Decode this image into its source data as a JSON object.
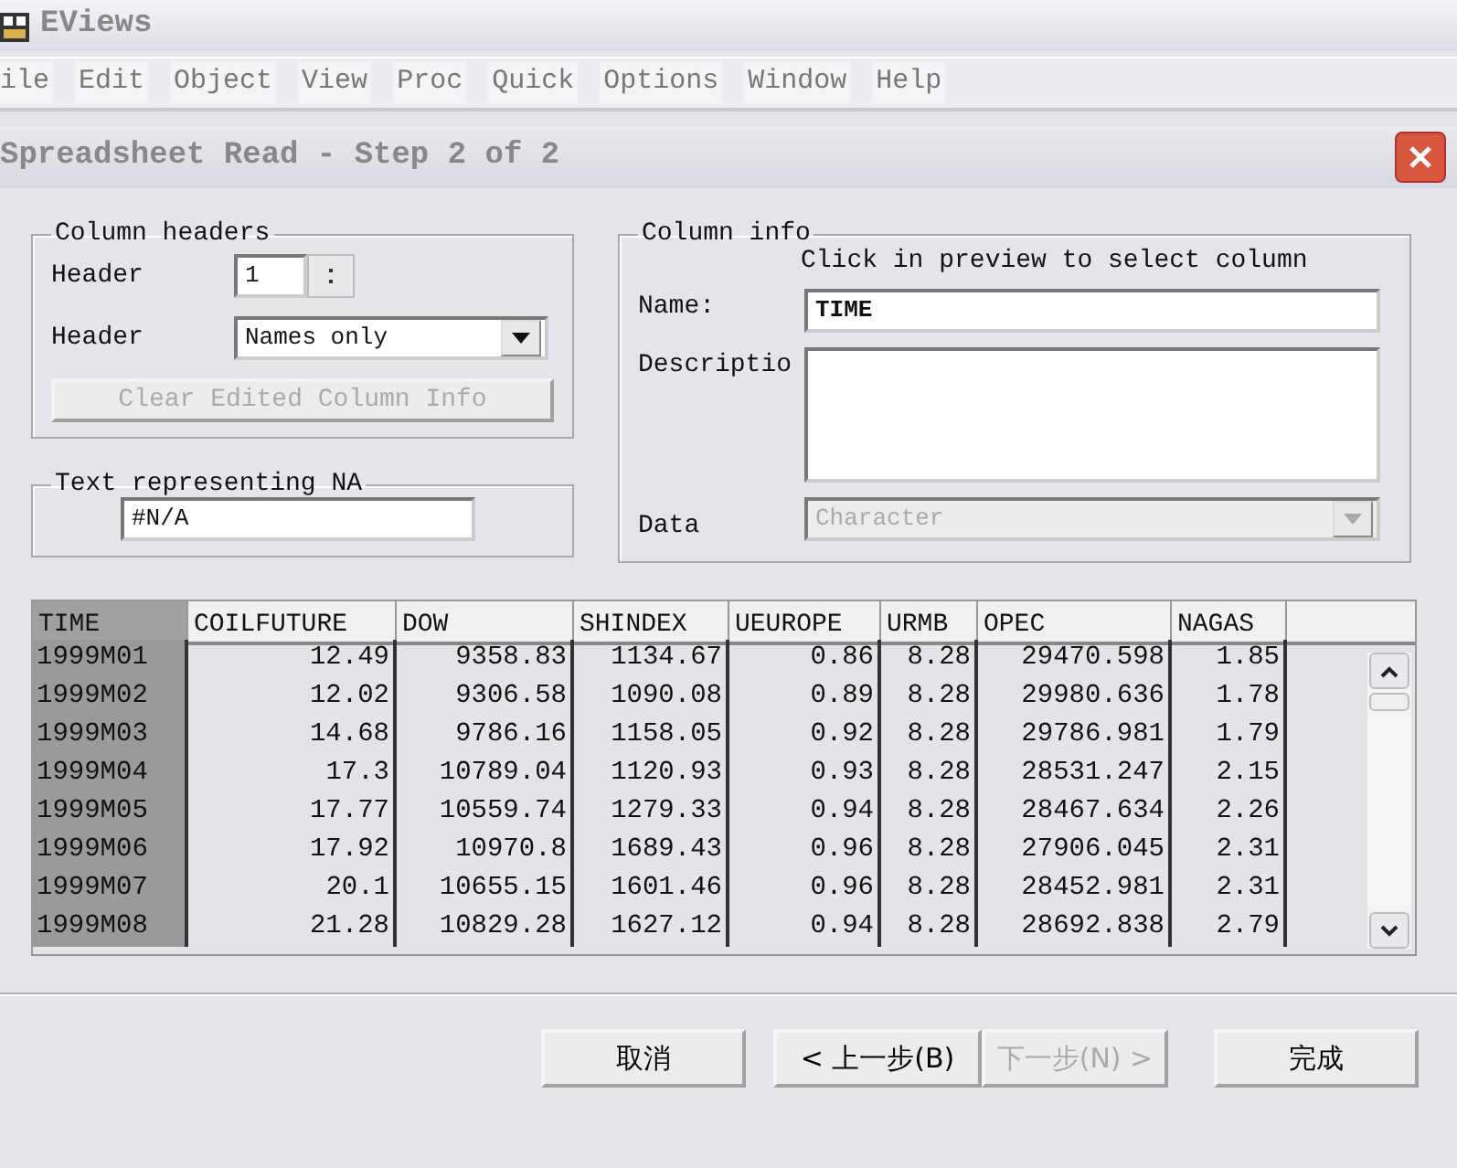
{
  "app": {
    "title": "EViews"
  },
  "menu": [
    "ile",
    "Edit",
    "Object",
    "View",
    "Proc",
    "Quick",
    "Options",
    "Window",
    "Help"
  ],
  "dialog": {
    "title": "Spreadsheet Read - Step 2 of 2",
    "column_headers": {
      "legend": "Column headers",
      "header_lines": {
        "label": "Header",
        "value": "1"
      },
      "header_type": {
        "label": "Header",
        "value": "Names only"
      },
      "clear_button": {
        "label": "Clear Edited Column Info",
        "disabled": true
      }
    },
    "na_text": {
      "legend": "Text representing NA",
      "value": "#N/A"
    },
    "column_info": {
      "legend": "Column info",
      "hint": "Click in preview to select column",
      "name": {
        "label": "Name:",
        "value": "TIME"
      },
      "description": {
        "label": "Descriptio"
      },
      "data": {
        "label": "Data",
        "value": "Character",
        "disabled": true
      }
    },
    "preview": {
      "columns": [
        {
          "label": "TIME",
          "selected": true
        },
        {
          "label": "COILFUTURE",
          "selected": false
        },
        {
          "label": "DOW",
          "selected": false
        },
        {
          "label": "SHINDEX",
          "selected": false
        },
        {
          "label": "UEUROPE",
          "selected": false
        },
        {
          "label": "URMB",
          "selected": false
        },
        {
          "label": "OPEC",
          "selected": false
        },
        {
          "label": "NAGAS",
          "selected": false
        }
      ],
      "rows": [
        [
          "1999M01",
          "12.49",
          "9358.83",
          "1134.67",
          "0.86",
          "8.28",
          "29470.598",
          "1.85"
        ],
        [
          "1999M02",
          "12.02",
          "9306.58",
          "1090.08",
          "0.89",
          "8.28",
          "29980.636",
          "1.78"
        ],
        [
          "1999M03",
          "14.68",
          "9786.16",
          "1158.05",
          "0.92",
          "8.28",
          "29786.981",
          "1.79"
        ],
        [
          "1999M04",
          "17.3",
          "10789.04",
          "1120.93",
          "0.93",
          "8.28",
          "28531.247",
          "2.15"
        ],
        [
          "1999M05",
          "17.77",
          "10559.74",
          "1279.33",
          "0.94",
          "8.28",
          "28467.634",
          "2.26"
        ],
        [
          "1999M06",
          "17.92",
          "10970.8",
          "1689.43",
          "0.96",
          "8.28",
          "27906.045",
          "2.31"
        ],
        [
          "1999M07",
          "20.1",
          "10655.15",
          "1601.46",
          "0.96",
          "8.28",
          "28452.981",
          "2.31"
        ],
        [
          "1999M08",
          "21.28",
          "10829.28",
          "1627.12",
          "0.94",
          "8.28",
          "28692.838",
          "2.79"
        ]
      ]
    },
    "buttons": [
      {
        "label": "取消",
        "disabled": false
      },
      {
        "label": "< 上一步(B)",
        "disabled": false
      },
      {
        "label": "下一步(N) >",
        "disabled": true
      },
      {
        "label": "完成",
        "disabled": false
      }
    ]
  }
}
